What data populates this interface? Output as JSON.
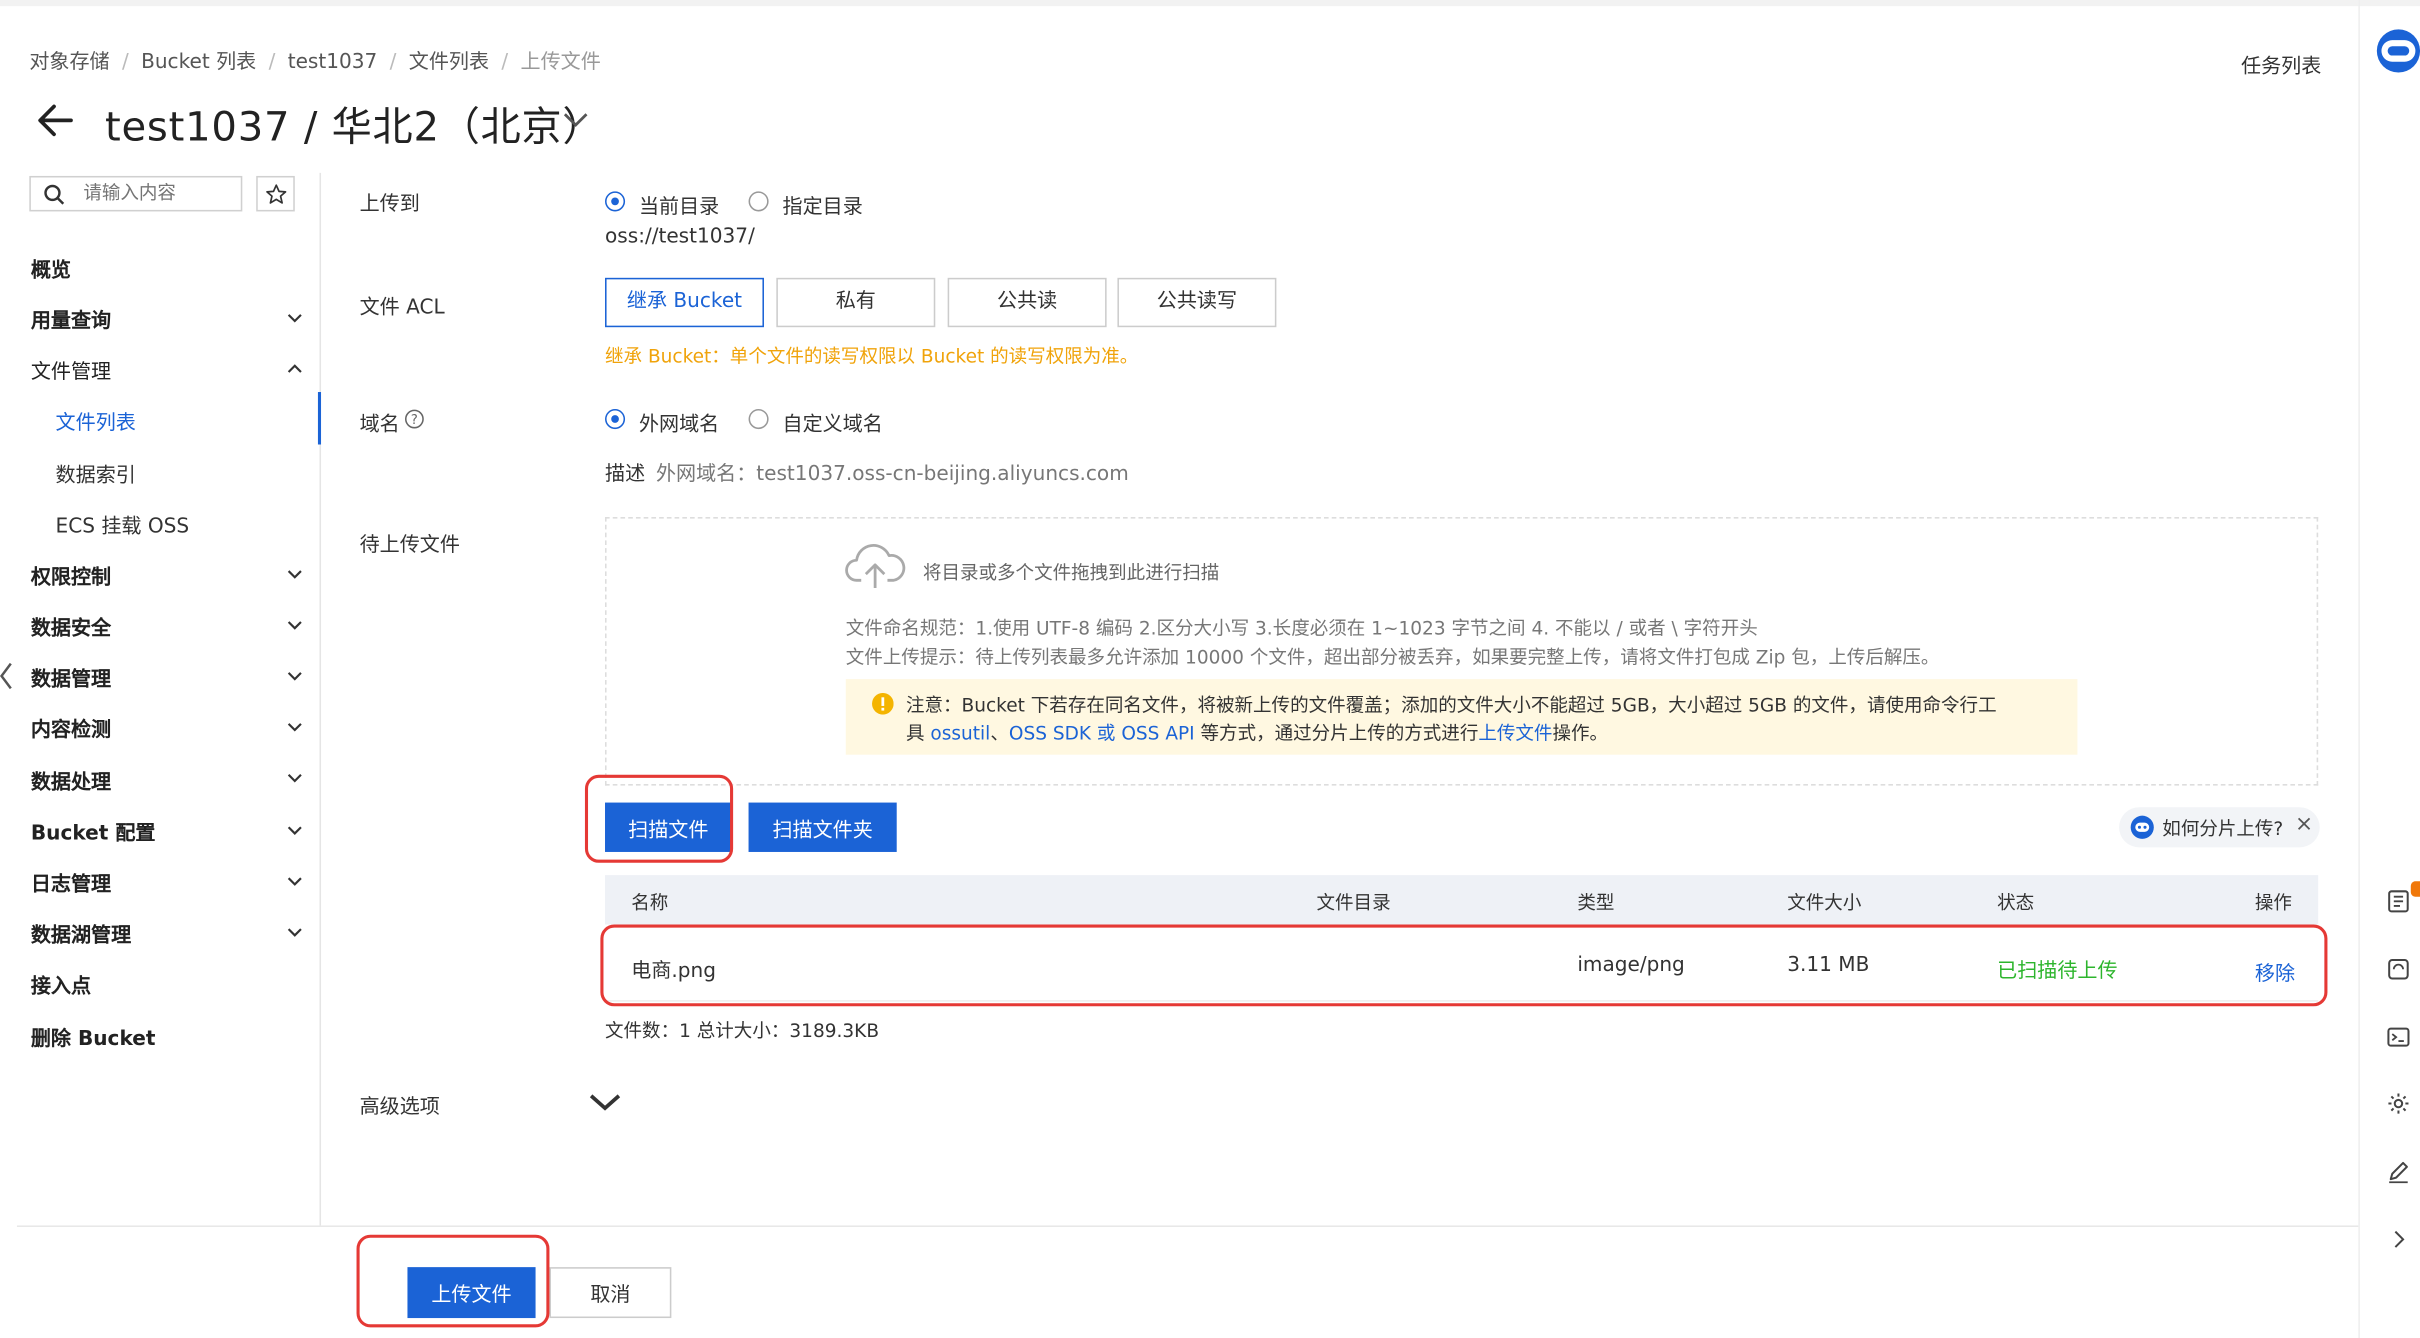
{
  "breadcrumb": [
    "对象存储",
    "Bucket 列表",
    "test1037",
    "文件列表",
    "上传文件"
  ],
  "header": {
    "title": "test1037 / 华北2（北京）",
    "task_list": "任务列表"
  },
  "sidebar": {
    "search_placeholder": "请输入内容",
    "items": [
      {
        "label": "概览",
        "expand": "none"
      },
      {
        "label": "用量查询",
        "expand": "down"
      },
      {
        "label": "文件管理",
        "expand": "up"
      },
      {
        "label": "文件列表",
        "sub": true,
        "active": true
      },
      {
        "label": "数据索引",
        "sub": true
      },
      {
        "label": "ECS 挂载 OSS",
        "sub": true
      },
      {
        "label": "权限控制",
        "expand": "down"
      },
      {
        "label": "数据安全",
        "expand": "down"
      },
      {
        "label": "数据管理",
        "expand": "down"
      },
      {
        "label": "内容检测",
        "expand": "down"
      },
      {
        "label": "数据处理",
        "expand": "down"
      },
      {
        "label": "Bucket 配置",
        "expand": "down"
      },
      {
        "label": "日志管理",
        "expand": "down"
      },
      {
        "label": "数据湖管理",
        "expand": "down"
      },
      {
        "label": "接入点",
        "expand": "none"
      },
      {
        "label": "删除 Bucket",
        "expand": "none"
      }
    ]
  },
  "form": {
    "upload_to": {
      "label": "上传到",
      "options": [
        "当前目录",
        "指定目录"
      ],
      "selected": "当前目录",
      "path": "oss://test1037/"
    },
    "acl": {
      "label": "文件 ACL",
      "options": [
        "继承 Bucket",
        "私有",
        "公共读",
        "公共读写"
      ],
      "selected": "继承 Bucket",
      "note": "继承 Bucket：单个文件的读写权限以 Bucket 的读写权限为准。"
    },
    "domain": {
      "label": "域名",
      "options": [
        "外网域名",
        "自定义域名"
      ],
      "selected": "外网域名",
      "desc_label": "描述",
      "desc_value": "外网域名：test1037.oss-cn-beijing.aliyuncs.com"
    },
    "pending": {
      "label": "待上传文件",
      "drop_text": "将目录或多个文件拖拽到此进行扫描",
      "rule1": "文件命名规范：1.使用 UTF-8 编码 2.区分大小写 3.长度必须在 1~1023 字节之间 4. 不能以 / 或者 \\ 字符开头",
      "rule2": "文件上传提示：待上传列表最多允许添加 10000 个文件，超出部分被丢弃，如果要完整上传，请将文件打包成 Zip 包，上传后解压。",
      "warn_line1": "注意：Bucket 下若存在同名文件，将被新上传的文件覆盖；添加的文件大小不能超过 5GB，大小超过 5GB 的文件，请使用命令行工",
      "warn_prefix": "具 ",
      "warn_link1": "ossutil",
      "warn_sep1": "、",
      "warn_link2": "OSS SDK",
      "warn_or": " 或 ",
      "warn_link3": "OSS API",
      "warn_mid": " 等方式，通过分片上传的方式进行",
      "warn_link4": "上传文件",
      "warn_end": "操作。",
      "scan_file": "扫描文件",
      "scan_folder": "扫描文件夹",
      "help": "如何分片上传?",
      "columns": [
        "名称",
        "文件目录",
        "类型",
        "文件大小",
        "状态",
        "操作"
      ],
      "rows": [
        {
          "name": "电商.png",
          "dir": "",
          "type": "image/png",
          "size": "3.11 MB",
          "status": "已扫描待上传",
          "action": "移除"
        }
      ],
      "summary": "文件数：1   总计大小：3189.3KB"
    },
    "advanced": {
      "label": "高级选项"
    }
  },
  "footer": {
    "upload": "上传文件",
    "cancel": "取消"
  },
  "colors": {
    "accent": "#1b63d6",
    "success": "#2db52d",
    "warning_text": "#f0a30a",
    "highlight": "#e53935"
  }
}
